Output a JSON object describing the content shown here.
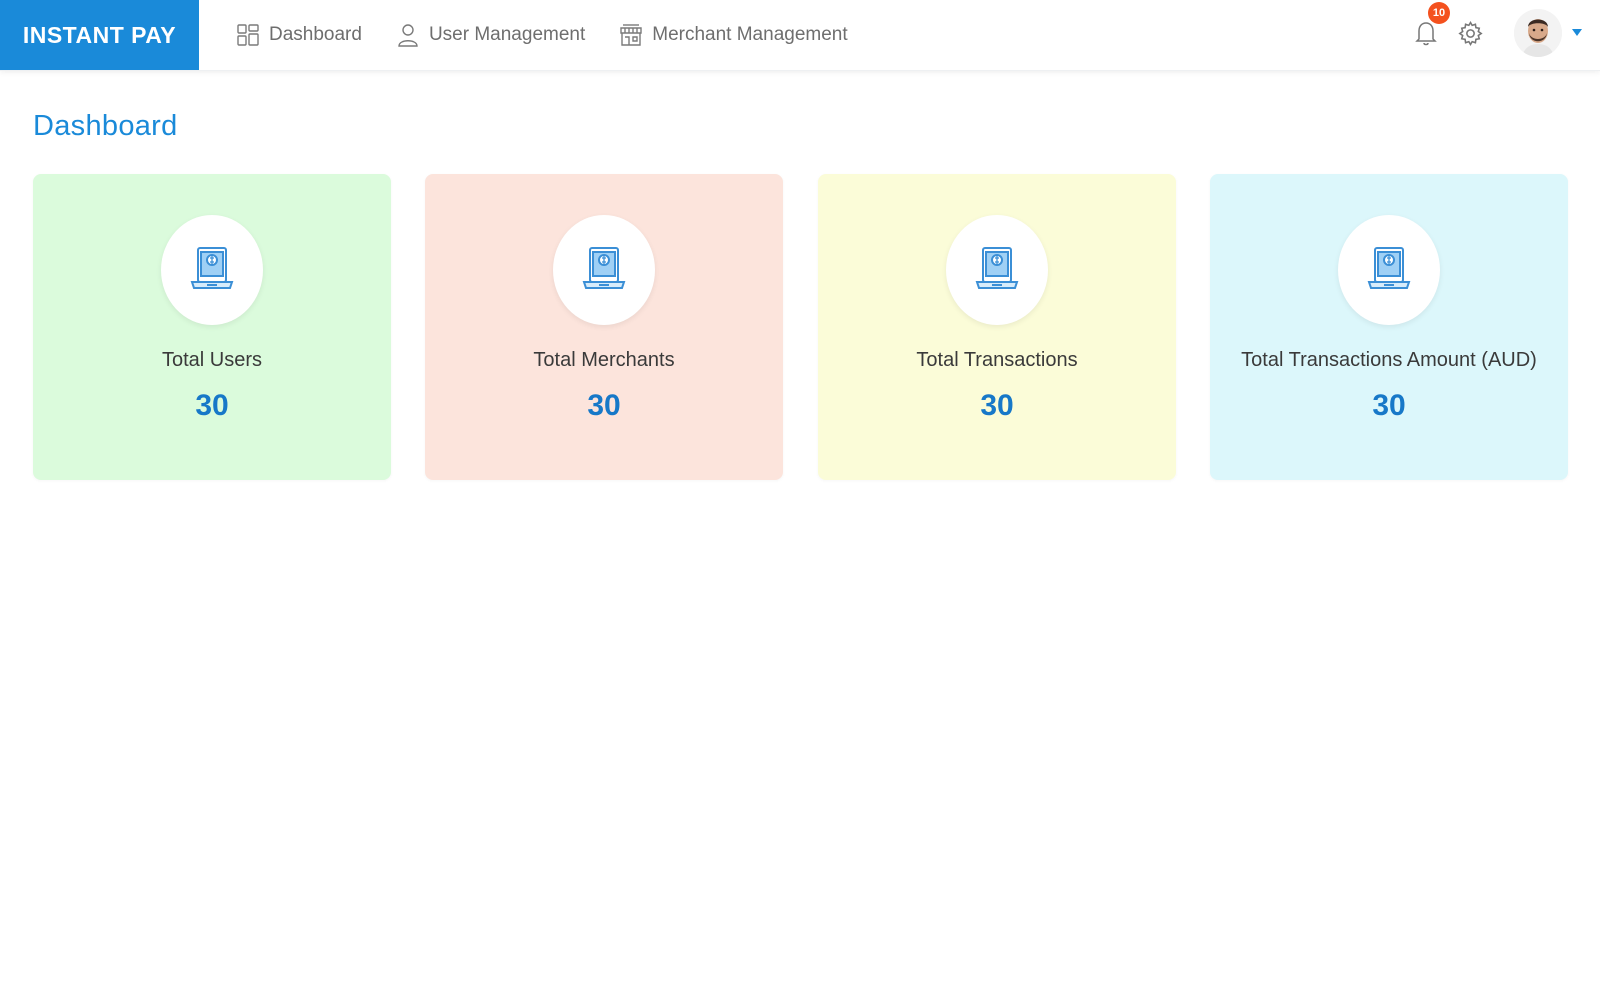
{
  "brand": {
    "label": "INSTANT PAY"
  },
  "nav": {
    "items": [
      {
        "label": "Dashboard",
        "icon": "dashboard-grid-icon"
      },
      {
        "label": "User Management",
        "icon": "user-icon"
      },
      {
        "label": "Merchant Management",
        "icon": "store-icon"
      }
    ]
  },
  "header": {
    "notification_count": "10",
    "icons": [
      "bell-icon",
      "gear-icon",
      "avatar",
      "caret-down-icon"
    ]
  },
  "page": {
    "title": "Dashboard"
  },
  "stats": [
    {
      "label": "Total Users",
      "value": "30",
      "bg": "#dbfbdc",
      "icon": "payment-device-icon"
    },
    {
      "label": "Total Merchants",
      "value": "30",
      "bg": "#fce4dc",
      "icon": "payment-device-icon"
    },
    {
      "label": "Total Transactions",
      "value": "30",
      "bg": "#fbfcd8",
      "icon": "payment-device-icon"
    },
    {
      "label": "Total Transactions Amount (AUD)",
      "value": "30",
      "bg": "#dcf7fb",
      "icon": "payment-device-icon"
    }
  ],
  "colors": {
    "accent": "#1a8ad9",
    "value_text": "#1778c8",
    "badge": "#f4511e"
  }
}
